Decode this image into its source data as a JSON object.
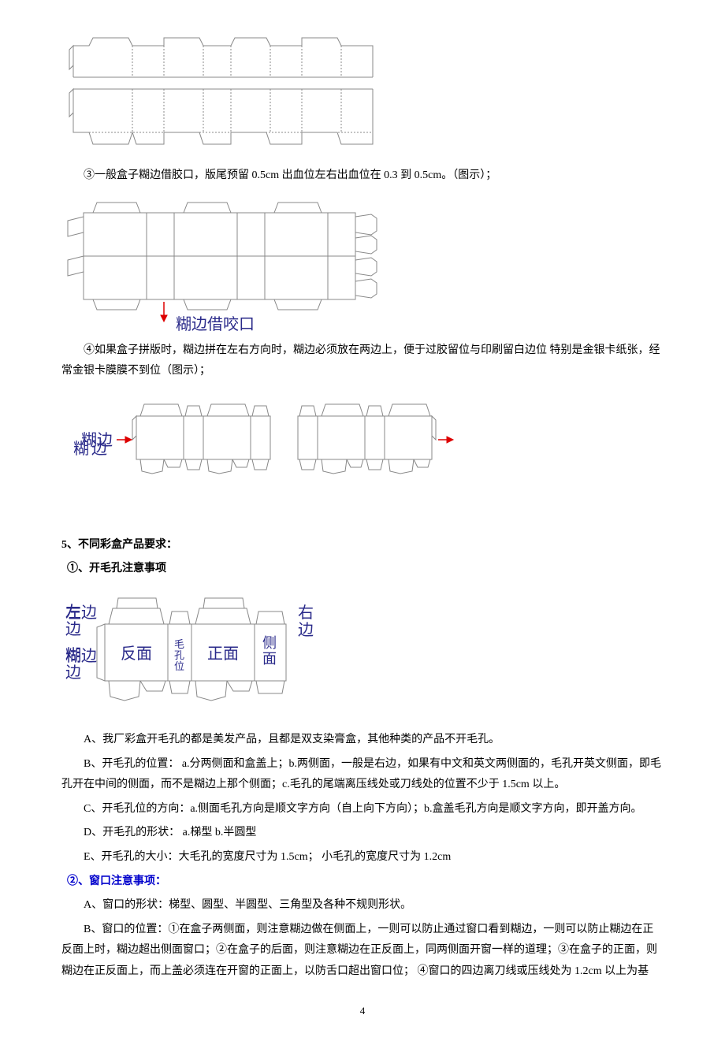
{
  "diagram1": {
    "alt": "box-dieline-diagram-1"
  },
  "para1": "③一般盒子糊边借胶口，版尾预留 0.5cm 出血位左右出血位在 0.3 到 0.5cm。（图示）；",
  "diagram2": {
    "alt": "box-dieline-diagram-2",
    "caption": "糊边借咬口",
    "arrow": "↓"
  },
  "para2": "④如果盒子拼版时，糊边拼在左右方向时，糊边必须放在两边上，便于过胶留位与印刷留白边位 特别是金银卡纸张，经常金银卡膜膜不到位（图示）；",
  "diagram3": {
    "alt": "box-dieline-diagram-3",
    "left_label": "糊边",
    "right_label": "糊边"
  },
  "section5_title": "5、不同彩盒产品要求：",
  "sub5_1_title": "①、开毛孔注意事项",
  "diagram4": {
    "alt": "box-dieline-diagram-4",
    "left_top": "左边",
    "left_bottom": "糊边",
    "panel_back": "反面",
    "panel_pore": "毛孔位",
    "panel_front": "正面",
    "panel_side": "侧面",
    "right_top": "右边"
  },
  "item_A": "A、我厂彩盒开毛孔的都是美发产品，且都是双支染膏盒，其他种类的产品不开毛孔。",
  "item_B": "B、开毛孔的位置：  a.分两侧面和盒盖上；b.两侧面，一般是右边，如果有中文和英文两侧面的，毛孔开英文侧面，即毛孔开在中间的侧面，而不是糊边上那个侧面；c.毛孔的尾端离压线处或刀线处的位置不少于 1.5cm 以上。",
  "item_C": "C、开毛孔位的方向：a.侧面毛孔方向是顺文字方向（自上向下方向）；b.盒盖毛孔方向是顺文字方向，即开盖方向。",
  "item_D": "D、开毛孔的形状：  a.梯型    b.半圆型",
  "item_E": "E、开毛孔的大小：大毛孔的宽度尺寸为 1.5cm；    小毛孔的宽度尺寸为 1.2cm",
  "sub5_2_title": "②、窗口注意事项：",
  "item2_A": "A、窗口的形状：梯型、圆型、半圆型、三角型及各种不规则形状。",
  "item2_B": "B、窗口的位置：①在盒子两侧面，则注意糊边做在侧面上，一则可以防止通过窗口看到糊边，一则可以防止糊边在正反面上时，糊边超出侧面窗口；②在盒子的后面，则注意糊边在正反面上，同两侧面开窗一样的道理；③在盒子的正面，则糊边在正反面上，而上盖必须连在开窗的正面上，以防舌口超出窗口位；  ④窗口的四边离刀线或压线处为 1.2cm 以上为基",
  "page_number": "4"
}
